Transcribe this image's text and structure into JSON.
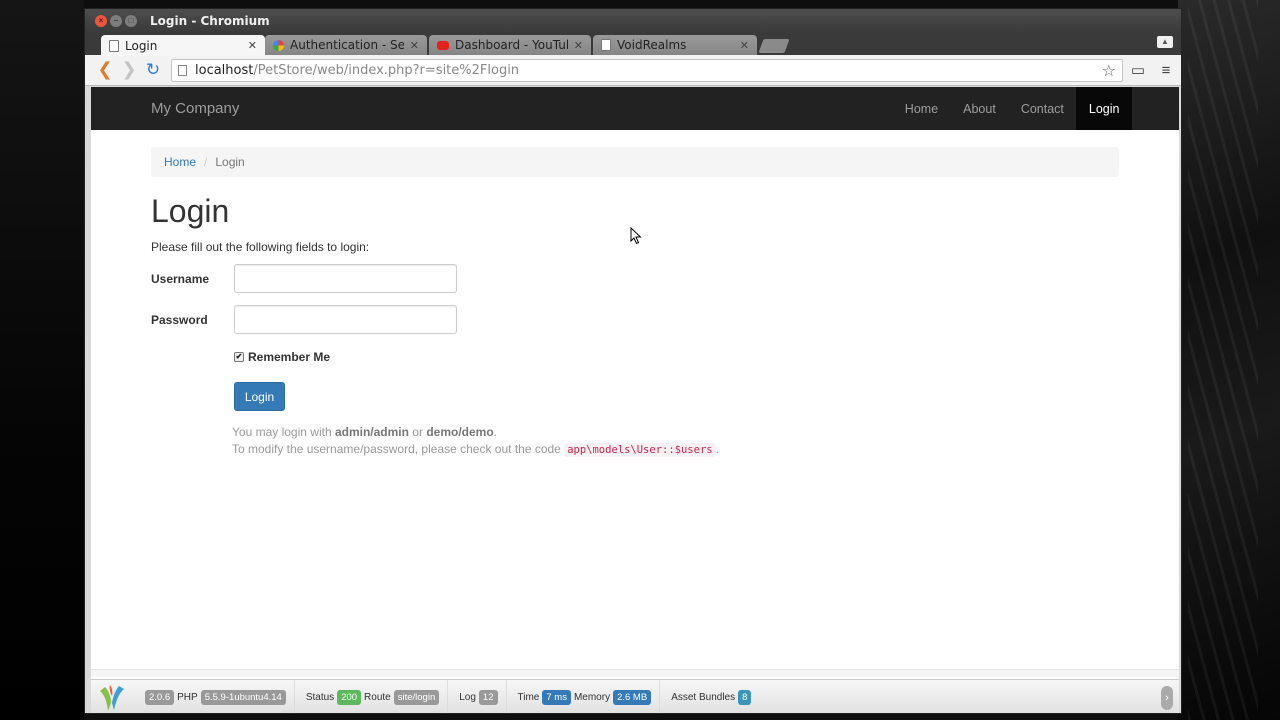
{
  "window": {
    "title": "Login - Chromium"
  },
  "tabs": [
    {
      "label": "Login",
      "icon": "page-icon",
      "active": true
    },
    {
      "label": "Authentication - Sec",
      "icon": "gmail-icon",
      "active": false
    },
    {
      "label": "Dashboard - YouTub",
      "icon": "youtube-icon",
      "active": false
    },
    {
      "label": "VoidRealms",
      "icon": "page-icon",
      "active": false
    }
  ],
  "address_bar": {
    "host": "localhost",
    "path": "/PetStore/web/index.php?r=site%2Flogin"
  },
  "navbar": {
    "brand": "My Company",
    "items": [
      "Home",
      "About",
      "Contact",
      "Login"
    ],
    "active": "Login"
  },
  "breadcrumb": {
    "home": "Home",
    "separator": "/",
    "current": "Login"
  },
  "main": {
    "title": "Login",
    "intro": "Please fill out the following fields to login:",
    "username_label": "Username",
    "username_value": "",
    "password_label": "Password",
    "password_value": "",
    "remember_label": "Remember Me",
    "remember_checked": true,
    "login_button": "Login",
    "hint1_pre": "You may login with ",
    "hint1_cred1": "admin/admin",
    "hint1_mid": " or ",
    "hint1_cred2": "demo/demo",
    "hint1_post": ".",
    "hint2_pre": "To modify the username/password, please check out the code ",
    "hint2_code": "app\\models\\User::$users",
    "hint2_post": "."
  },
  "debug_toolbar": {
    "yii_version": "2.0.6",
    "php_label": "PHP",
    "php_version": "5.5.9-1ubuntu4.14",
    "status_label": "Status",
    "status_value": "200",
    "route_label": "Route",
    "route_value": "site/login",
    "log_label": "Log",
    "log_value": "12",
    "time_label": "Time",
    "time_value": "7 ms",
    "memory_label": "Memory",
    "memory_value": "2.6 MB",
    "assets_label": "Asset Bundles",
    "assets_value": "8"
  },
  "colors": {
    "navbar_bg": "#222222",
    "link": "#337ab7",
    "button_primary": "#337ab7",
    "status_ok": "#5cb85c",
    "code_text": "#c7254e"
  }
}
